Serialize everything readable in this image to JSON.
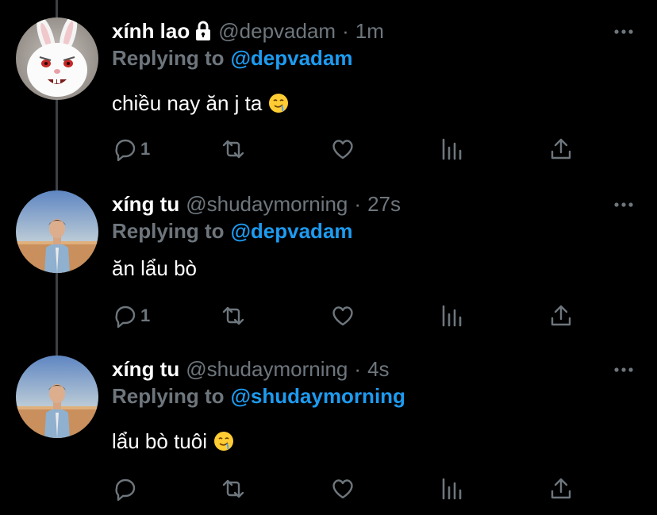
{
  "colors": {
    "background": "#000000",
    "secondary_text": "#6e767d",
    "link": "#1d9bf0",
    "thread_line": "#3d4146"
  },
  "tweets": [
    {
      "display_name": "xính lao",
      "locked": true,
      "handle": "@depvadam",
      "separator": "·",
      "time": "1m",
      "replying_label": "Replying to",
      "replying_to": "@depvadam",
      "text": "chiều nay ăn j ta",
      "emoji": "drooling-face",
      "reply_count": "1",
      "avatar": "snowball-rabbit-avatar"
    },
    {
      "display_name": "xíng tu",
      "locked": false,
      "handle": "@shudaymorning",
      "separator": "·",
      "time": "27s",
      "replying_label": "Replying to",
      "replying_to": "@depvadam",
      "text": "ăn lẩu bò",
      "emoji": "",
      "reply_count": "1",
      "avatar": "desert-portrait-avatar"
    },
    {
      "display_name": "xíng tu",
      "locked": false,
      "handle": "@shudaymorning",
      "separator": "·",
      "time": "4s",
      "replying_label": "Replying to",
      "replying_to": "@shudaymorning",
      "text": "lẩu bò tuôi",
      "emoji": "drooling-face",
      "reply_count": "",
      "avatar": "desert-portrait-avatar"
    }
  ],
  "action_icons": [
    "reply-icon",
    "retweet-icon",
    "like-icon",
    "analytics-icon",
    "share-icon"
  ]
}
